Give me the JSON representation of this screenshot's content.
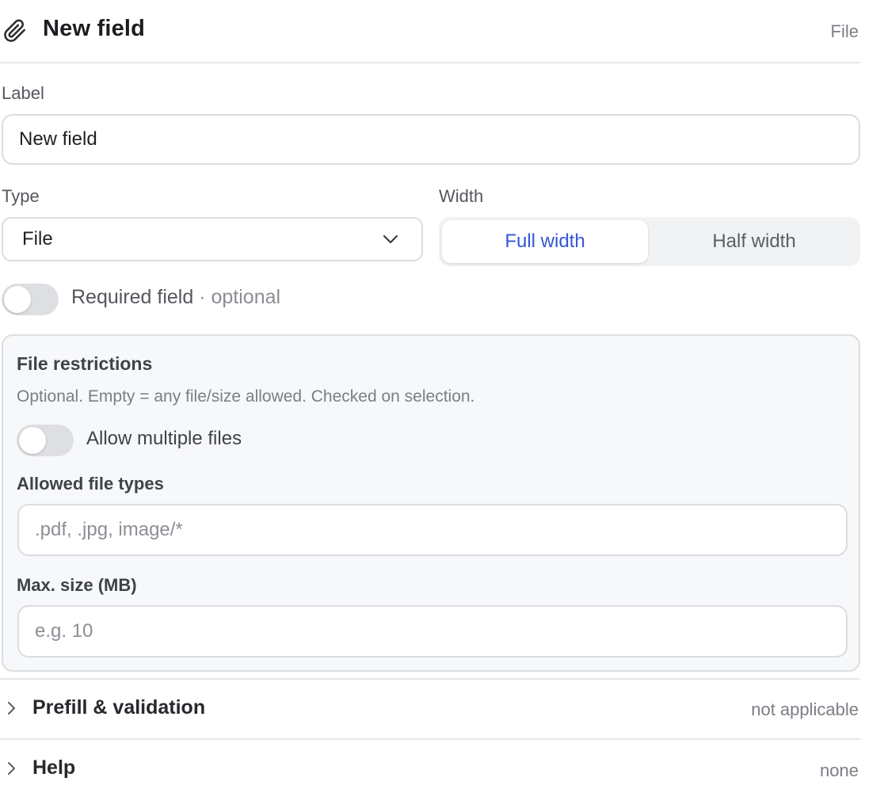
{
  "header": {
    "icon": "paperclip-icon",
    "title": "New field",
    "kind": "File"
  },
  "label_field": {
    "label": "Label",
    "value": "New field"
  },
  "type_field": {
    "label": "Type",
    "value": "File"
  },
  "width_field": {
    "label": "Width",
    "options": [
      "Full width",
      "Half width"
    ],
    "selected": "Full width"
  },
  "required": {
    "label": "Required field",
    "suffix": " · optional",
    "enabled": false
  },
  "restrictions": {
    "title": "File restrictions",
    "description": "Optional. Empty = any file/size allowed. Checked on selection.",
    "multiple_label": "Allow multiple files",
    "multiple_enabled": false,
    "types_label": "Allowed file types",
    "types_placeholder": ".pdf, .jpg, image/*",
    "size_label": "Max. size (MB)",
    "size_placeholder": "e.g. 10"
  },
  "sections": [
    {
      "title": "Prefill & validation",
      "status": "not applicable"
    },
    {
      "title": "Help",
      "status": "none"
    }
  ],
  "colors": {
    "accent": "#3555d6",
    "panel_bg": "#f7f8fa",
    "toggle_off": "#dedfe2"
  }
}
